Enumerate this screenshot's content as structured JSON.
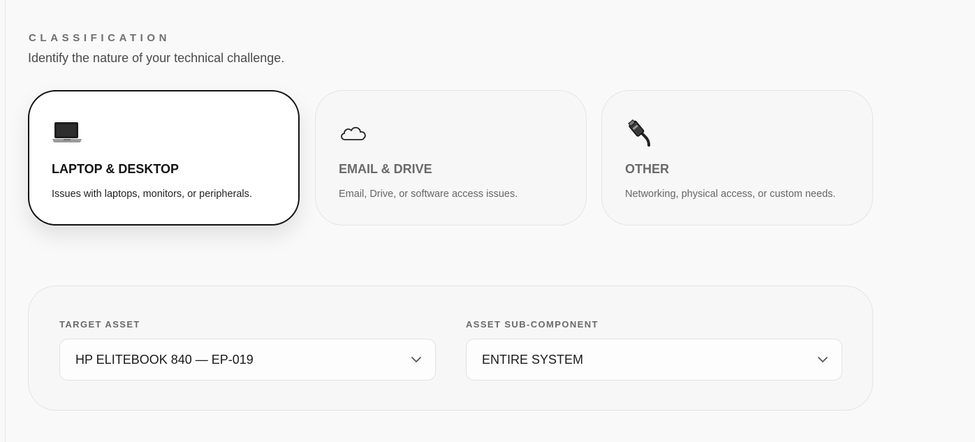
{
  "classification": {
    "label": "CLASSIFICATION",
    "subtitle": "Identify the nature of your technical challenge."
  },
  "categories": [
    {
      "icon": "laptop-icon",
      "title": "LAPTOP & DESKTOP",
      "description": "Issues with laptops, monitors, or peripherals.",
      "selected": true
    },
    {
      "icon": "cloud-icon",
      "title": "EMAIL & DRIVE",
      "description": "Email, Drive, or software access issues.",
      "selected": false
    },
    {
      "icon": "ethernet-cable-icon",
      "title": "OTHER",
      "description": "Networking, physical access, or custom needs.",
      "selected": false
    }
  ],
  "asset": {
    "target_label": "TARGET ASSET",
    "target_value": "HP ELITEBOOK 840 — EP-019",
    "sub_label": "ASSET SUB-COMPONENT",
    "sub_value": "ENTIRE SYSTEM"
  },
  "colors": {
    "selected_border": "#111111",
    "background": "#f9f9f9"
  }
}
